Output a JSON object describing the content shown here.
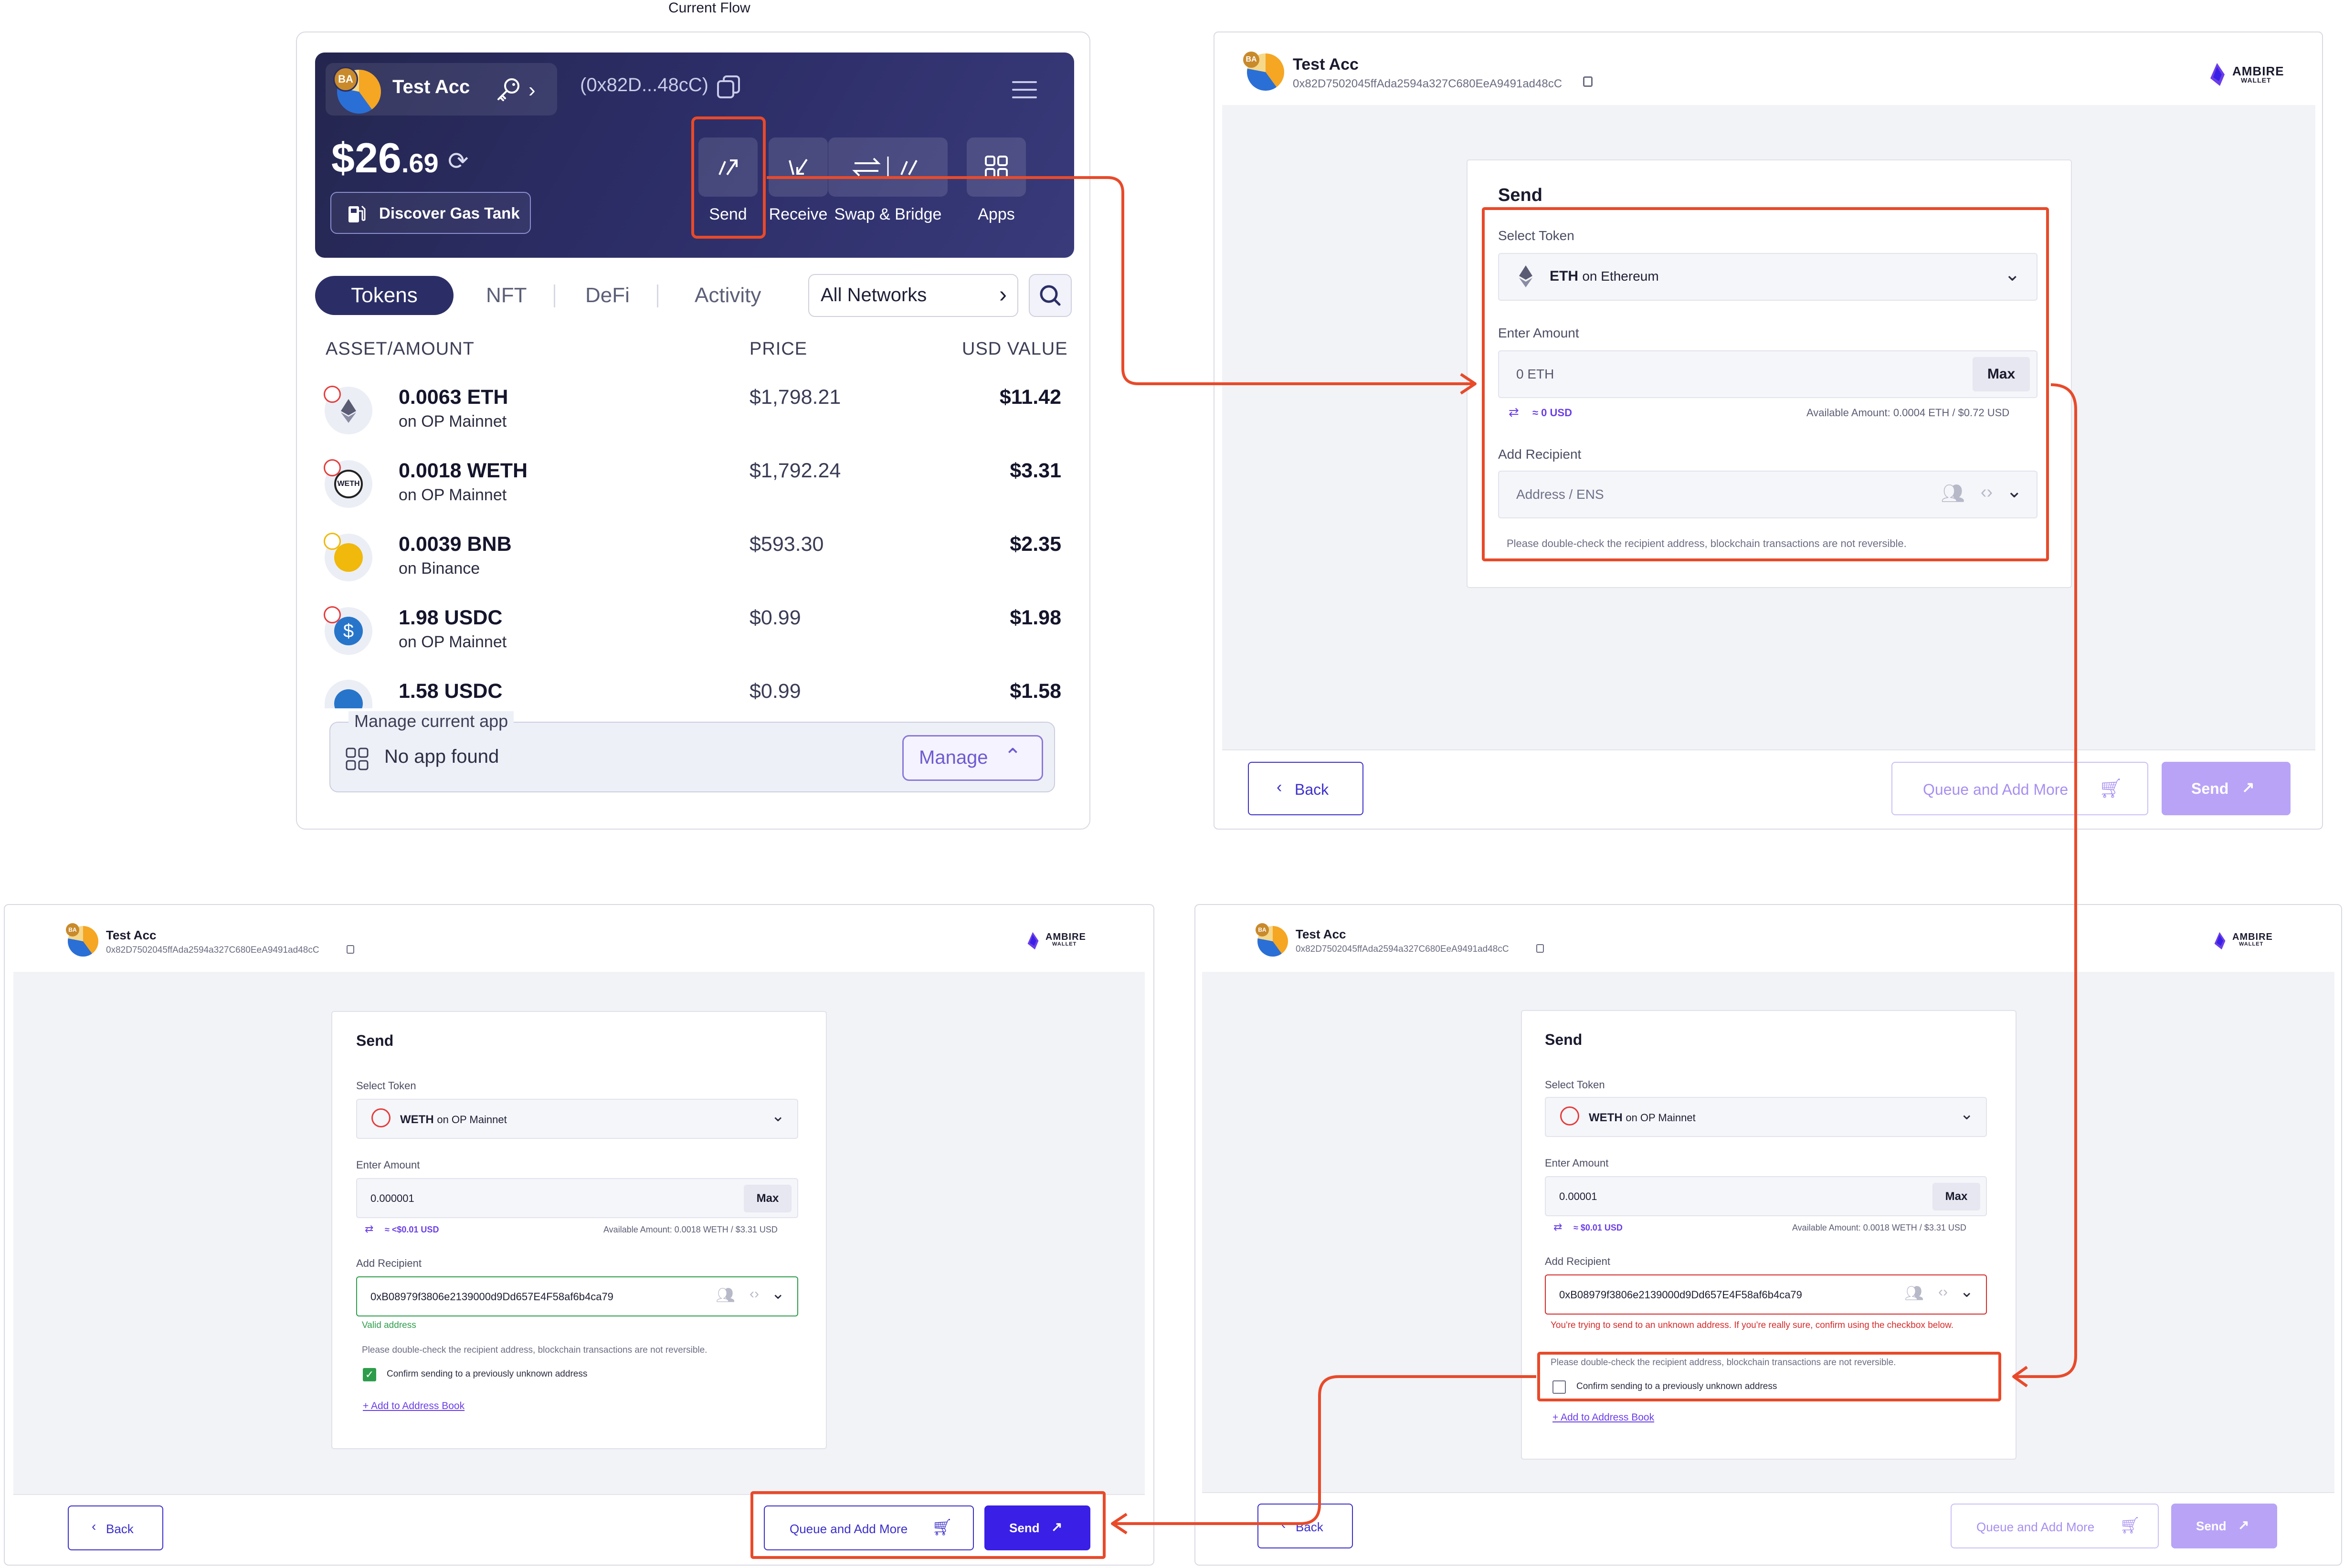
{
  "flow_title": "Current Flow",
  "popup": {
    "account_badge": "BA",
    "account_name": "Test Acc",
    "address_short": "(0x82D...48cC)",
    "balance_main": "$26",
    "balance_cents": ".69",
    "gas_tank_label": "Discover Gas Tank",
    "actions": [
      "Send",
      "Receive",
      "Swap & Bridge",
      "Apps"
    ],
    "tabs": [
      "Tokens",
      "NFT",
      "DeFi",
      "Activity"
    ],
    "network_filter": "All Networks",
    "headers": {
      "asset": "ASSET/AMOUNT",
      "price": "PRICE",
      "usd": "USD VALUE"
    },
    "tokens": [
      {
        "amount": "0.0063 ETH",
        "chain": "on OP Mainnet",
        "price": "$1,798.21",
        "usd": "$11.42"
      },
      {
        "amount": "0.0018 WETH",
        "chain": "on OP Mainnet",
        "price": "$1,792.24",
        "usd": "$3.31"
      },
      {
        "amount": "0.0039 BNB",
        "chain": "on Binance",
        "price": "$593.30",
        "usd": "$2.35"
      },
      {
        "amount": "1.98 USDC",
        "chain": "on OP Mainnet",
        "price": "$0.99",
        "usd": "$1.98"
      },
      {
        "amount": "1.58 USDC",
        "chain": "",
        "price": "$0.99",
        "usd": "$1.58"
      }
    ],
    "manage_legend": "Manage current app",
    "no_app": "No app found",
    "manage_button": "Manage"
  },
  "common": {
    "account_name": "Test Acc",
    "account_badge": "BA",
    "address_full": "0x82D7502045ffAda2594a327C680EeA9491ad48cC",
    "logo_line1": "AMBIRE",
    "logo_line2": "WALLET",
    "send_title": "Send",
    "select_token_label": "Select Token",
    "enter_amount_label": "Enter Amount",
    "add_recipient_label": "Add Recipient",
    "max_label": "Max",
    "back_label": "Back",
    "queue_label": "Queue and Add More",
    "send_label": "Send",
    "double_check": "Please double-check the recipient address, blockchain transactions are not reversible.",
    "confirm_unknown": "Confirm sending to a previously unknown address",
    "add_address_book": "+ Add to Address Book"
  },
  "screen1": {
    "token_symbol": "ETH",
    "token_chain": "on Ethereum",
    "amount": "0 ETH",
    "usd_est": "≈ 0 USD",
    "available": "Available Amount: 0.0004 ETH / $0.72 USD",
    "recipient_placeholder": "Address / ENS"
  },
  "screen2": {
    "token_symbol": "WETH",
    "token_chain": "on OP Mainnet",
    "amount": "0.000001",
    "usd_est": "≈ <$0.01 USD",
    "available": "Available Amount: 0.0018 WETH / $3.31 USD",
    "recipient": "0xB08979f3806e2139000d9Dd657E4F58af6b4ca79",
    "valid_msg": "Valid address"
  },
  "screen3": {
    "token_symbol": "WETH",
    "token_chain": "on OP Mainnet",
    "amount": "0.00001",
    "usd_est": "≈ $0.01 USD",
    "available": "Available Amount: 0.0018 WETH / $3.31 USD",
    "recipient": "0xB08979f3806e2139000d9Dd657E4F58af6b4ca79",
    "error_msg": "You're trying to send to an unknown address. If you're really sure, confirm using the checkbox below."
  },
  "colors": {
    "accent": "#3a1fe6",
    "highlight": "#e84a2a",
    "popup_bg": "#2b2e66",
    "success": "#2e9d4b",
    "error": "#d62a2a"
  }
}
